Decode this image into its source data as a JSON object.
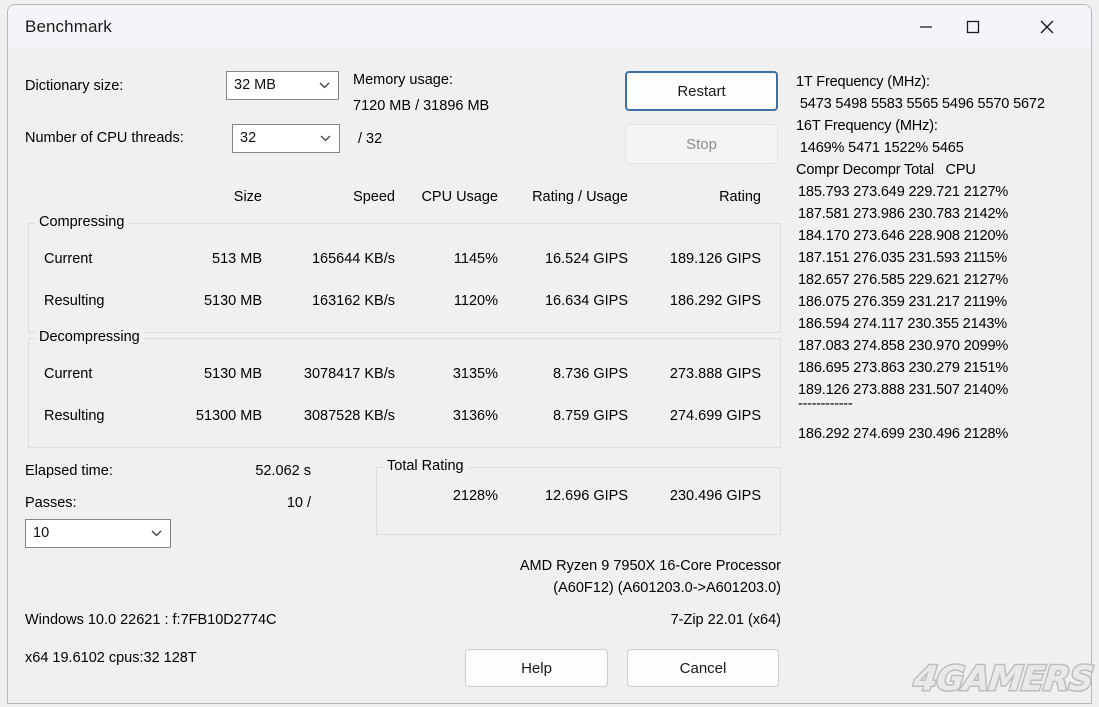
{
  "window": {
    "title": "Benchmark",
    "controls": {
      "minimize": "minimize-icon",
      "maximize": "maximize-icon",
      "close": "close-icon"
    }
  },
  "settings": {
    "dictionary_label": "Dictionary size:",
    "dictionary_value": "32 MB",
    "threads_label": "Number of CPU threads:",
    "threads_value": "32",
    "threads_total": "/ 32",
    "memory_label": "Memory usage:",
    "memory_value": "7120 MB / 31896 MB"
  },
  "actions": {
    "restart": "Restart",
    "stop": "Stop",
    "help": "Help",
    "cancel": "Cancel"
  },
  "table": {
    "headers": {
      "size": "Size",
      "speed": "Speed",
      "cpu_usage": "CPU Usage",
      "rating_usage": "Rating / Usage",
      "rating": "Rating"
    },
    "compressing": {
      "group_label": "Compressing",
      "rows": [
        {
          "name": "Current",
          "size": "513 MB",
          "speed": "165644 KB/s",
          "cpu_usage": "1145%",
          "rating_usage": "16.524 GIPS",
          "rating": "189.126 GIPS"
        },
        {
          "name": "Resulting",
          "size": "5130 MB",
          "speed": "163162 KB/s",
          "cpu_usage": "1120%",
          "rating_usage": "16.634 GIPS",
          "rating": "186.292 GIPS"
        }
      ]
    },
    "decompressing": {
      "group_label": "Decompressing",
      "rows": [
        {
          "name": "Current",
          "size": "5130 MB",
          "speed": "3078417 KB/s",
          "cpu_usage": "3135%",
          "rating_usage": "8.736 GIPS",
          "rating": "273.888 GIPS"
        },
        {
          "name": "Resulting",
          "size": "51300 MB",
          "speed": "3087528 KB/s",
          "cpu_usage": "3136%",
          "rating_usage": "8.759 GIPS",
          "rating": "274.699 GIPS"
        }
      ]
    }
  },
  "status": {
    "elapsed_label": "Elapsed time:",
    "elapsed_value": "52.062 s",
    "passes_label": "Passes:",
    "passes_value": "10 /",
    "passes_select_value": "10"
  },
  "total_rating": {
    "group_label": "Total Rating",
    "cpu_usage": "2128%",
    "rating_usage": "12.696 GIPS",
    "rating": "230.496 GIPS"
  },
  "log": {
    "freq_1t_label": "1T Frequency (MHz):",
    "freq_1t_values": " 5473 5498 5583 5565 5496 5570 5672",
    "freq_16t_label": "16T Frequency (MHz):",
    "freq_16t_values": " 1469% 5471 1522% 5465",
    "columns": "Compr Decompr Total   CPU",
    "rows": [
      "185.793 273.649 229.721 2127%",
      "187.581 273.986 230.783 2142%",
      "184.170 273.646 228.908 2120%",
      "187.151 276.035 231.593 2115%",
      "182.657 276.585 229.621 2127%",
      "186.075 276.359 231.217 2119%",
      "186.594 274.117 230.355 2143%",
      "187.083 274.858 230.970 2099%",
      "186.695 273.863 230.279 2151%",
      "189.126 273.888 231.507 2140%"
    ],
    "separator": "------------",
    "average": "186.292 274.699 230.496 2128%"
  },
  "footer": {
    "cpu_name": "AMD Ryzen 9 7950X 16-Core Processor",
    "cpu_id": "(A60F12) (A601203.0->A601203.0)",
    "os": "Windows 10.0 22621 :  f:7FB10D2774C",
    "app_version": "7-Zip 22.01 (x64)",
    "build": "x64 19.6102 cpus:32 128T"
  },
  "watermark": {
    "text": "4GAMERS"
  }
}
